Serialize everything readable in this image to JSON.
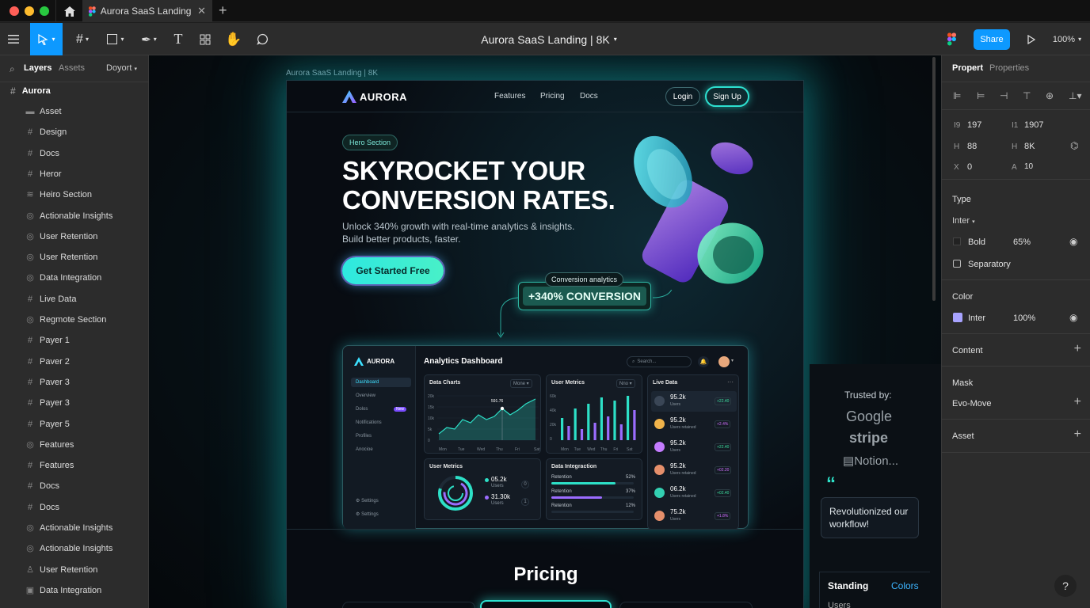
{
  "titlebar": {
    "tab_title": "Aurora SaaS Landing | 8",
    "colors": {
      "close": "#ff5f57",
      "min": "#febc2e",
      "max": "#28c840"
    }
  },
  "toolbar": {
    "file_title": "Aurora SaaS Landing | 8K",
    "share_label": "Share",
    "zoom": "100%",
    "accent": "#0d99ff"
  },
  "left": {
    "tabs": {
      "layers": "Layers",
      "assets": "Assets",
      "page": "Doyort"
    },
    "root": "Aurora",
    "layers": [
      "Asset",
      "Design",
      "Docs",
      "Heror",
      "Heiro Section",
      "Actionable Insights",
      "User Retention",
      "User Retention",
      "Data Integration",
      "Live Data",
      "Regmote Section",
      "Payer 1",
      "Paver 2",
      "Paver 3",
      "Payer 3",
      "Payer 5",
      "Features",
      "Features",
      "Docs",
      "Docs",
      "Actionable Insights",
      "Actionable Insights",
      "User Retention",
      "Data Integration"
    ]
  },
  "right": {
    "tabs": {
      "propert": "Propert",
      "properties": "Properties"
    },
    "xy": {
      "x_label": "I9",
      "x": "197",
      "y_label": "I1",
      "y": "1907"
    },
    "wh": {
      "w_label": "H",
      "w": "88",
      "h_label": "H",
      "h": "8K"
    },
    "rot": {
      "r_label": "X",
      "r": "0",
      "c_label": "A",
      "c": "10"
    },
    "type_title": "Type",
    "font": "Inter",
    "weight": "Bold",
    "weight_pct": "65%",
    "separatory": "Separatory",
    "color_title": "Color",
    "color_name": "Inter",
    "color_pct": "100%",
    "color_swatch": "#a8a3ff",
    "content": "Content",
    "mask": "Mask",
    "evo_move": "Evo-Move",
    "asset": "Asset"
  },
  "canvas": {
    "frame_label": "Aurora SaaS Landing | 8K",
    "nav": {
      "brand": "AURORA",
      "links": [
        "Features",
        "Pricing",
        "Docs"
      ],
      "login": "Login",
      "signup": "Sign Up"
    },
    "hero": {
      "badge": "Hero Section",
      "headline_1": "SKYROCKET YOUR",
      "headline_2": "CONVERSION RATES.",
      "sub_1": "Unlock 340% growth with real-time analytics & insights.",
      "sub_2": "Build better products, faster.",
      "cta": "Get Started Free",
      "callout_label": "Conversion analytics",
      "callout_value": "+340% CONVERSION"
    },
    "dashboard": {
      "brand": "AURORA",
      "title": "Analytics Dashboard",
      "search": "Search...",
      "nav": [
        "Dashboard",
        "Overview",
        "Dolos",
        "Notifications",
        "Profiles",
        "Anocioe"
      ],
      "nav_badge": "New",
      "nav_bottom": [
        "Settings",
        "Settings"
      ],
      "data_charts": "Data Charts",
      "data_charts_sel": "Mone",
      "data_charts_point": "591.76",
      "user_metrics": "User Metrics",
      "user_metrics_sel": "Nno",
      "live_data": "Live Data",
      "user_metrics_2": "User Metrics",
      "um2_values": [
        {
          "v": "05.2k",
          "l": "Users",
          "n": "0"
        },
        {
          "v": "31.30k",
          "l": "Users",
          "n": "1"
        }
      ],
      "data_integration": "Data Integraction",
      "di_rows": [
        {
          "label": "Retention",
          "pct": "52%",
          "fill": 0.78,
          "color": "#2de0c7"
        },
        {
          "label": "Retention",
          "pct": "37%",
          "fill": 0.62,
          "color": "#9b6cff"
        },
        {
          "label": "Retention",
          "pct": "12%",
          "fill": 0.0,
          "color": "#2de0c7"
        }
      ],
      "live_rows": [
        {
          "value": "95.2k",
          "sub": "Users",
          "delta": "+22.40"
        },
        {
          "value": "95.2k",
          "sub": "Users retained",
          "delta": "+2.4%"
        },
        {
          "value": "95.2k",
          "sub": "Users",
          "delta": "+22.40"
        },
        {
          "value": "95.2k",
          "sub": "Users retained",
          "delta": "+02.20"
        },
        {
          "value": "06.2k",
          "sub": "Users retained",
          "delta": "+02.40"
        },
        {
          "value": "75.2k",
          "sub": "Users",
          "delta": "+1.8%"
        }
      ],
      "area_x": [
        "Mon",
        "Tue",
        "Wed",
        "Thu",
        "Fri",
        "Sat"
      ],
      "area_y": [
        "20k",
        "15k",
        "10k",
        "5k",
        "0"
      ],
      "bar_x": [
        "Mon",
        "Tue",
        "Wed",
        "Thu",
        "Fri",
        "Sat"
      ],
      "bar_y": [
        "60k",
        "40k",
        "20k",
        "0"
      ]
    },
    "pricing": "Pricing",
    "side": {
      "trusted": "Trusted by:",
      "logos": [
        "Google",
        "stripe",
        "Notion..."
      ],
      "quote": "Revolutionized our workflow!",
      "standing": "Standing",
      "colors": "Colors",
      "users": "Users"
    }
  }
}
